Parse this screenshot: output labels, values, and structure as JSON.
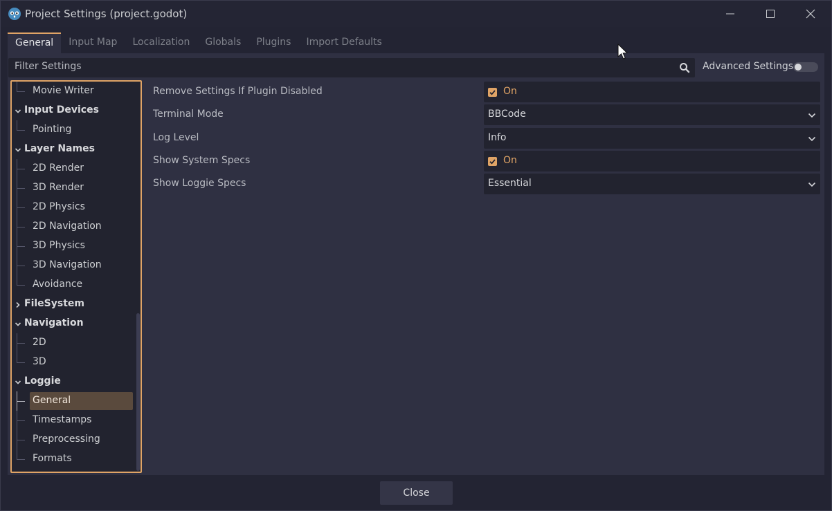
{
  "window": {
    "title": "Project Settings (project.godot)"
  },
  "tabs": [
    "General",
    "Input Map",
    "Localization",
    "Globals",
    "Plugins",
    "Import Defaults"
  ],
  "active_tab": "General",
  "filter": {
    "placeholder": "Filter Settings"
  },
  "advanced": {
    "label": "Advanced Settings",
    "enabled": false
  },
  "tree": [
    {
      "label": "Movie Writer",
      "kind": "child"
    },
    {
      "label": "Input Devices",
      "kind": "section",
      "expanded": true
    },
    {
      "label": "Pointing",
      "kind": "child"
    },
    {
      "label": "Layer Names",
      "kind": "section",
      "expanded": true
    },
    {
      "label": "2D Render",
      "kind": "child"
    },
    {
      "label": "3D Render",
      "kind": "child"
    },
    {
      "label": "2D Physics",
      "kind": "child"
    },
    {
      "label": "2D Navigation",
      "kind": "child"
    },
    {
      "label": "3D Physics",
      "kind": "child"
    },
    {
      "label": "3D Navigation",
      "kind": "child"
    },
    {
      "label": "Avoidance",
      "kind": "child"
    },
    {
      "label": "FileSystem",
      "kind": "section",
      "expanded": false
    },
    {
      "label": "Navigation",
      "kind": "section",
      "expanded": true
    },
    {
      "label": "2D",
      "kind": "child"
    },
    {
      "label": "3D",
      "kind": "child"
    },
    {
      "label": "Loggie",
      "kind": "section",
      "expanded": true
    },
    {
      "label": "General",
      "kind": "child",
      "selected": true
    },
    {
      "label": "Timestamps",
      "kind": "child"
    },
    {
      "label": "Preprocessing",
      "kind": "child"
    },
    {
      "label": "Formats",
      "kind": "child"
    }
  ],
  "properties": [
    {
      "name": "Remove Settings If Plugin Disabled",
      "type": "bool",
      "value": "On"
    },
    {
      "name": "Terminal Mode",
      "type": "enum",
      "value": "BBCode"
    },
    {
      "name": "Log Level",
      "type": "enum",
      "value": "Info"
    },
    {
      "name": "Show System Specs",
      "type": "bool",
      "value": "On"
    },
    {
      "name": "Show Loggie Specs",
      "type": "enum",
      "value": "Essential"
    }
  ],
  "footer": {
    "close_label": "Close"
  },
  "colors": {
    "accent": "#e0a466",
    "background": "#232433",
    "panel": "#2f3042",
    "field": "#22232f"
  }
}
